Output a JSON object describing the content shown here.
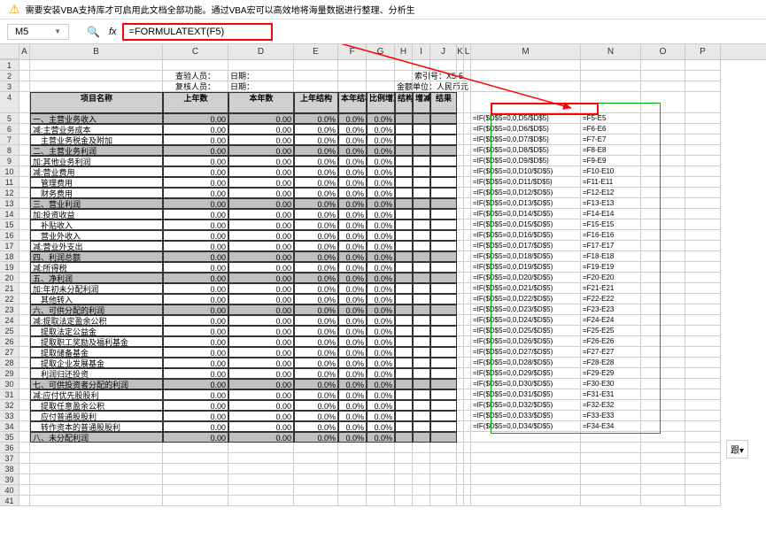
{
  "warning_text": "需要安装VBA支持库才可启用此文档全部功能。通过VBA宏可以高效地将海量数据进行整理、分析生",
  "cell_ref": "M5",
  "formula_text": "=FORMULATEXT(F5)",
  "col_headers": [
    "A",
    "B",
    "C",
    "D",
    "E",
    "F",
    "G",
    "H",
    "I",
    "J",
    "K",
    "L",
    "M",
    "N",
    "O",
    "P"
  ],
  "info_row1": {
    "b_label": "查验人员：",
    "d_label": "日期：",
    "i_label": "索引号：X5-5"
  },
  "info_row2": {
    "b_label": "复核人员：",
    "d_label": "日期：",
    "i_label": "金额单位：人民币元"
  },
  "headers": [
    "项目名称",
    "上年数",
    "本年数",
    "上年结构",
    "本年结构",
    "比例增减",
    "结构排序",
    "增减排序",
    "结果"
  ],
  "rows": [
    {
      "n": 5,
      "name": "一、主营业务收入",
      "c": "0.00",
      "d": "0.00",
      "e": "0.0%",
      "f": "0.0%",
      "g": "0.0%",
      "gray": true,
      "m": "=IF($D$5=0,0,D5/$D$5)",
      "nn": "=F5-E5",
      "red": true
    },
    {
      "n": 6,
      "name": "减:主营业务成本",
      "c": "0.00",
      "d": "0.00",
      "e": "0.0%",
      "f": "0.0%",
      "g": "0.0%",
      "m": "=IF($D$5=0,0,D6/$D$5)",
      "nn": "=F6-E6"
    },
    {
      "n": 7,
      "name": "　主营业务税金及附加",
      "c": "0.00",
      "d": "0.00",
      "e": "0.0%",
      "f": "0.0%",
      "g": "0.0%",
      "m": "=IF($D$5=0,0,D7/$D$5)",
      "nn": "=F7-E7"
    },
    {
      "n": 8,
      "name": "二、主营业务利润",
      "c": "0.00",
      "d": "0.00",
      "e": "0.0%",
      "f": "0.0%",
      "g": "0.0%",
      "gray": true,
      "m": "=IF($D$5=0,0,D8/$D$5)",
      "nn": "=F8-E8"
    },
    {
      "n": 9,
      "name": "加:其他业务利润",
      "c": "0.00",
      "d": "0.00",
      "e": "0.0%",
      "f": "0.0%",
      "g": "0.0%",
      "m": "=IF($D$5=0,0,D9/$D$5)",
      "nn": "=F9-E9"
    },
    {
      "n": 10,
      "name": "减:营业费用",
      "c": "0.00",
      "d": "0.00",
      "e": "0.0%",
      "f": "0.0%",
      "g": "0.0%",
      "m": "=IF($D$5=0,0,D10/$D$5)",
      "nn": "=F10-E10"
    },
    {
      "n": 11,
      "name": "　管理费用",
      "c": "0.00",
      "d": "0.00",
      "e": "0.0%",
      "f": "0.0%",
      "g": "0.0%",
      "m": "=IF($D$5=0,0,D11/$D$5)",
      "nn": "=F11-E11"
    },
    {
      "n": 12,
      "name": "　财务费用",
      "c": "0.00",
      "d": "0.00",
      "e": "0.0%",
      "f": "0.0%",
      "g": "0.0%",
      "m": "=IF($D$5=0,0,D12/$D$5)",
      "nn": "=F12-E12"
    },
    {
      "n": 13,
      "name": "三、营业利润",
      "c": "0.00",
      "d": "0.00",
      "e": "0.0%",
      "f": "0.0%",
      "g": "0.0%",
      "gray": true,
      "m": "=IF($D$5=0,0,D13/$D$5)",
      "nn": "=F13-E13"
    },
    {
      "n": 14,
      "name": "加:投资收益",
      "c": "0.00",
      "d": "0.00",
      "e": "0.0%",
      "f": "0.0%",
      "g": "0.0%",
      "m": "=IF($D$5=0,0,D14/$D$5)",
      "nn": "=F14-E14"
    },
    {
      "n": 15,
      "name": "　补贴收入",
      "c": "0.00",
      "d": "0.00",
      "e": "0.0%",
      "f": "0.0%",
      "g": "0.0%",
      "m": "=IF($D$5=0,0,D15/$D$5)",
      "nn": "=F15-E15"
    },
    {
      "n": 16,
      "name": "　营业外收入",
      "c": "0.00",
      "d": "0.00",
      "e": "0.0%",
      "f": "0.0%",
      "g": "0.0%",
      "m": "=IF($D$5=0,0,D16/$D$5)",
      "nn": "=F16-E16"
    },
    {
      "n": 17,
      "name": "减:营业外支出",
      "c": "0.00",
      "d": "0.00",
      "e": "0.0%",
      "f": "0.0%",
      "g": "0.0%",
      "m": "=IF($D$5=0,0,D17/$D$5)",
      "nn": "=F17-E17"
    },
    {
      "n": 18,
      "name": "四、利润总额",
      "c": "0.00",
      "d": "0.00",
      "e": "0.0%",
      "f": "0.0%",
      "g": "0.0%",
      "gray": true,
      "m": "=IF($D$5=0,0,D18/$D$5)",
      "nn": "=F18-E18"
    },
    {
      "n": 19,
      "name": "减:所得税",
      "c": "0.00",
      "d": "0.00",
      "e": "0.0%",
      "f": "0.0%",
      "g": "0.0%",
      "m": "=IF($D$5=0,0,D19/$D$5)",
      "nn": "=F19-E19"
    },
    {
      "n": 20,
      "name": "五、净利润",
      "c": "0.00",
      "d": "0.00",
      "e": "0.0%",
      "f": "0.0%",
      "g": "0.0%",
      "gray": true,
      "m": "=IF($D$5=0,0,D20/$D$5)",
      "nn": "=F20-E20"
    },
    {
      "n": 21,
      "name": "加:年初未分配利润",
      "c": "0.00",
      "d": "0.00",
      "e": "0.0%",
      "f": "0.0%",
      "g": "0.0%",
      "m": "=IF($D$5=0,0,D21/$D$5)",
      "nn": "=F21-E21"
    },
    {
      "n": 22,
      "name": "　其他转入",
      "c": "0.00",
      "d": "0.00",
      "e": "0.0%",
      "f": "0.0%",
      "g": "0.0%",
      "m": "=IF($D$5=0,0,D22/$D$5)",
      "nn": "=F22-E22"
    },
    {
      "n": 23,
      "name": "六、可供分配的利润",
      "c": "0.00",
      "d": "0.00",
      "e": "0.0%",
      "f": "0.0%",
      "g": "0.0%",
      "gray": true,
      "m": "=IF($D$5=0,0,D23/$D$5)",
      "nn": "=F23-E23"
    },
    {
      "n": 24,
      "name": "减:提取法定盈余公积",
      "c": "0.00",
      "d": "0.00",
      "e": "0.0%",
      "f": "0.0%",
      "g": "0.0%",
      "m": "=IF($D$5=0,0,D24/$D$5)",
      "nn": "=F24-E24"
    },
    {
      "n": 25,
      "name": "　提取法定公益金",
      "c": "0.00",
      "d": "0.00",
      "e": "0.0%",
      "f": "0.0%",
      "g": "0.0%",
      "m": "=IF($D$5=0,0,D25/$D$5)",
      "nn": "=F25-E25"
    },
    {
      "n": 26,
      "name": "　提取职工奖励及福利基金",
      "c": "0.00",
      "d": "0.00",
      "e": "0.0%",
      "f": "0.0%",
      "g": "0.0%",
      "m": "=IF($D$5=0,0,D26/$D$5)",
      "nn": "=F26-E26"
    },
    {
      "n": 27,
      "name": "　提取储备基金",
      "c": "0.00",
      "d": "0.00",
      "e": "0.0%",
      "f": "0.0%",
      "g": "0.0%",
      "m": "=IF($D$5=0,0,D27/$D$5)",
      "nn": "=F27-E27"
    },
    {
      "n": 28,
      "name": "　提取企业发展基金",
      "c": "0.00",
      "d": "0.00",
      "e": "0.0%",
      "f": "0.0%",
      "g": "0.0%",
      "m": "=IF($D$5=0,0,D28/$D$5)",
      "nn": "=F28-E28"
    },
    {
      "n": 29,
      "name": "　利润归还投资",
      "c": "0.00",
      "d": "0.00",
      "e": "0.0%",
      "f": "0.0%",
      "g": "0.0%",
      "m": "=IF($D$5=0,0,D29/$D$5)",
      "nn": "=F29-E29"
    },
    {
      "n": 30,
      "name": "七、可供投资者分配的利润",
      "c": "0.00",
      "d": "0.00",
      "e": "0.0%",
      "f": "0.0%",
      "g": "0.0%",
      "gray": true,
      "m": "=IF($D$5=0,0,D30/$D$5)",
      "nn": "=F30-E30"
    },
    {
      "n": 31,
      "name": "减:应付优先股股利",
      "c": "0.00",
      "d": "0.00",
      "e": "0.0%",
      "f": "0.0%",
      "g": "0.0%",
      "m": "=IF($D$5=0,0,D31/$D$5)",
      "nn": "=F31-E31"
    },
    {
      "n": 32,
      "name": "　提取任意盈余公积",
      "c": "0.00",
      "d": "0.00",
      "e": "0.0%",
      "f": "0.0%",
      "g": "0.0%",
      "m": "=IF($D$5=0,0,D32/$D$5)",
      "nn": "=F32-E32"
    },
    {
      "n": 33,
      "name": "　应付普通股股利",
      "c": "0.00",
      "d": "0.00",
      "e": "0.0%",
      "f": "0.0%",
      "g": "0.0%",
      "m": "=IF($D$5=0,0,D33/$D$5)",
      "nn": "=F33-E33"
    },
    {
      "n": 34,
      "name": "　转作资本的普通股股利",
      "c": "0.00",
      "d": "0.00",
      "e": "0.0%",
      "f": "0.0%",
      "g": "0.0%",
      "m": "=IF($D$5=0,0,D34/$D$5)",
      "nn": "=F34-E34"
    },
    {
      "n": 35,
      "name": "八、未分配利润",
      "c": "0.00",
      "d": "0.00",
      "e": "0.0%",
      "f": "0.0%",
      "g": "0.0%",
      "gray": true,
      "m": "",
      "nn": ""
    }
  ],
  "empty_rows": [
    36,
    37,
    38,
    39,
    40,
    41
  ],
  "float_btn": "跟▾"
}
